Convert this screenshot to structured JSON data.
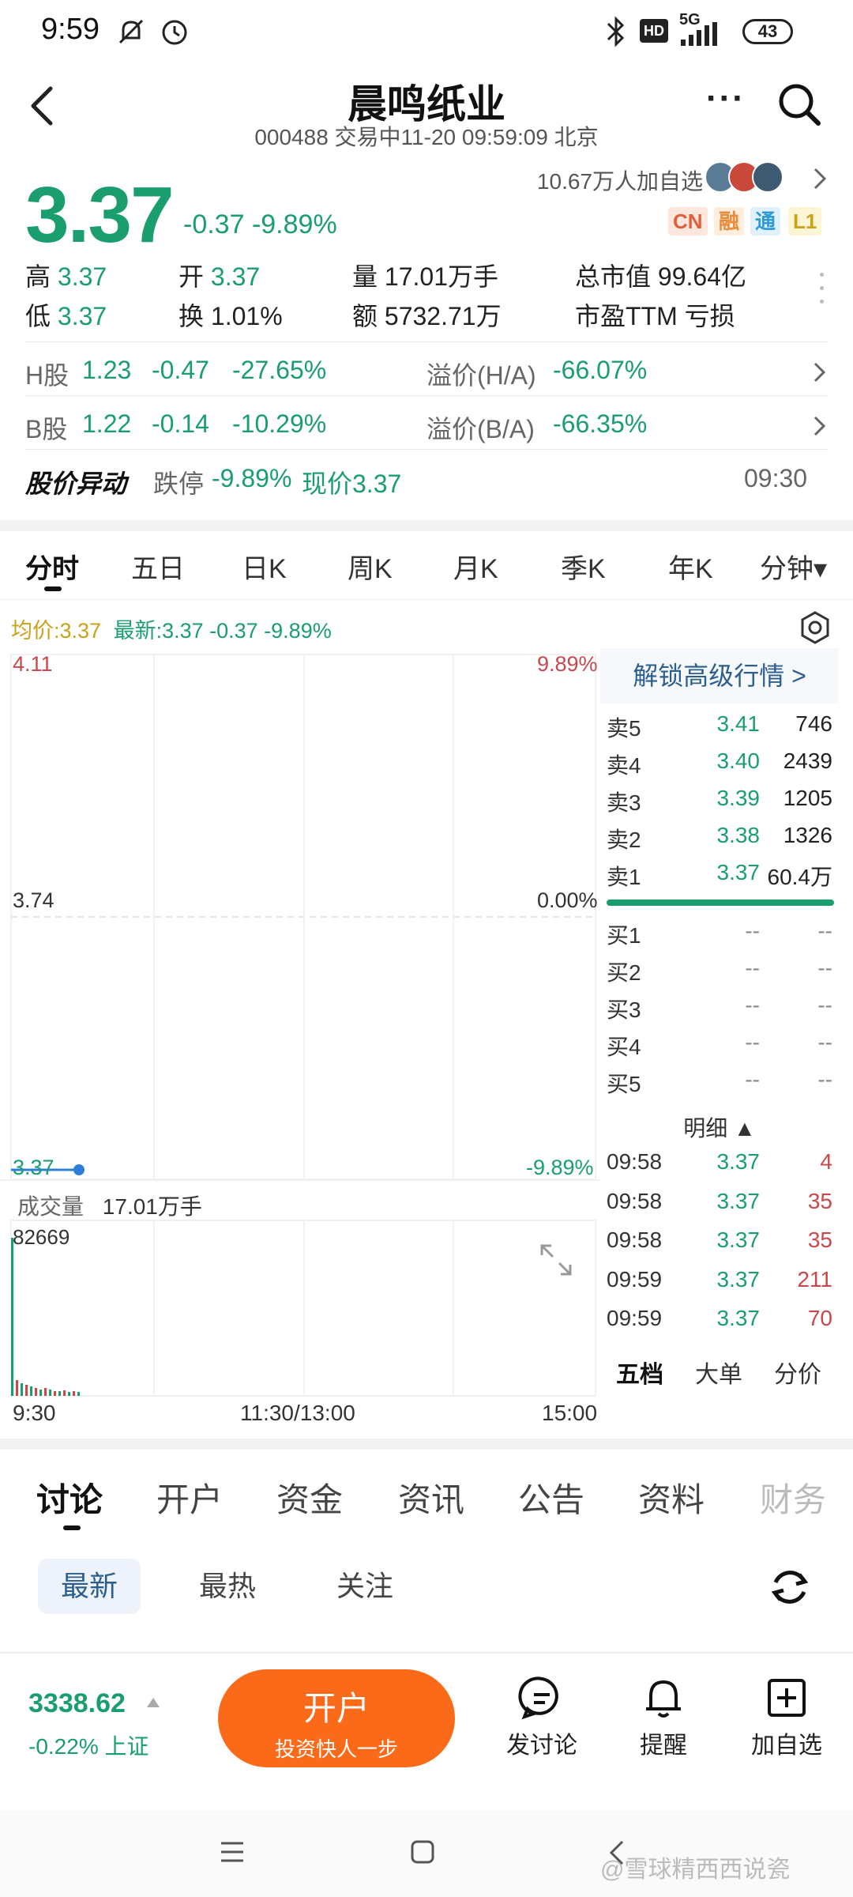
{
  "status_bar": {
    "time": "9:59",
    "network": "5G",
    "battery": "43"
  },
  "header": {
    "title": "晨鸣纸业",
    "subtitle": "000488 交易中11-20 09:59:09 北京"
  },
  "quote": {
    "price": "3.37",
    "change": "-0.37",
    "change_pct": "-9.89%",
    "watchers": "10.67万人加自选",
    "badges": [
      "CN",
      "融",
      "通",
      "L1"
    ],
    "stats": [
      {
        "label": "高",
        "value": "3.37"
      },
      {
        "label": "开",
        "value": "3.37"
      },
      {
        "label": "量",
        "value": "17.01万手"
      },
      {
        "label": "总市值",
        "value": "99.64亿"
      },
      {
        "label": "低",
        "value": "3.37"
      },
      {
        "label": "换",
        "value": "1.01%"
      },
      {
        "label": "额",
        "value": "5732.71万"
      },
      {
        "label": "市盈TTM",
        "value": "亏损"
      }
    ]
  },
  "hshares": {
    "label": "H股",
    "price": "1.23",
    "chg": "-0.47",
    "pct": "-27.65%",
    "prem_label": "溢价(H/A)",
    "prem": "-66.07%"
  },
  "bshares": {
    "label": "B股",
    "price": "1.22",
    "chg": "-0.14",
    "pct": "-10.29%",
    "prem_label": "溢价(B/A)",
    "prem": "-66.35%"
  },
  "alert": {
    "title": "股价异动",
    "text_prefix": "跌停",
    "text_pct": "-9.89%",
    "text_suffix": "现价3.37",
    "time": "09:30"
  },
  "chart_tabs": [
    "分时",
    "五日",
    "日K",
    "周K",
    "月K",
    "季K",
    "年K",
    "分钟▾"
  ],
  "chart": {
    "avg_label": "均价:3.37",
    "latest_label": "最新:3.37 -0.37 -9.89%",
    "y_top": "4.11",
    "y_mid": "3.74",
    "y_bot": "3.37",
    "pct_top": "9.89%",
    "pct_mid": "0.00%",
    "pct_bot": "-9.89%",
    "volume_label": "成交量",
    "volume_value": "17.01万手",
    "volume_max": "82669",
    "x_labels": [
      "9:30",
      "11:30/13:00",
      "15:00"
    ]
  },
  "orderbook": {
    "unlock": "解锁高级行情 >",
    "asks": [
      {
        "label": "卖5",
        "price": "3.41",
        "vol": "746"
      },
      {
        "label": "卖4",
        "price": "3.40",
        "vol": "2439"
      },
      {
        "label": "卖3",
        "price": "3.39",
        "vol": "1205"
      },
      {
        "label": "卖2",
        "price": "3.38",
        "vol": "1326"
      },
      {
        "label": "卖1",
        "price": "3.37",
        "vol": "60.4万"
      }
    ],
    "bids": [
      {
        "label": "买1",
        "price": "--",
        "vol": "--"
      },
      {
        "label": "买2",
        "price": "--",
        "vol": "--"
      },
      {
        "label": "买3",
        "price": "--",
        "vol": "--"
      },
      {
        "label": "买4",
        "price": "--",
        "vol": "--"
      },
      {
        "label": "买5",
        "price": "--",
        "vol": "--"
      }
    ],
    "detail_label": "明细 ▲",
    "trades": [
      {
        "time": "09:58",
        "price": "3.37",
        "vol": "4"
      },
      {
        "time": "09:58",
        "price": "3.37",
        "vol": "35"
      },
      {
        "time": "09:58",
        "price": "3.37",
        "vol": "35"
      },
      {
        "time": "09:59",
        "price": "3.37",
        "vol": "211"
      },
      {
        "time": "09:59",
        "price": "3.37",
        "vol": "70"
      }
    ],
    "tabs": [
      "五档",
      "大单",
      "分价"
    ]
  },
  "section_tabs": [
    "讨论",
    "开户",
    "资金",
    "资讯",
    "公告",
    "资料",
    "财务"
  ],
  "sub_tabs": [
    "最新",
    "最热",
    "关注"
  ],
  "bottom": {
    "index_value": "3338.62",
    "index_change": "-0.22% 上证",
    "open_title": "开户",
    "open_sub": "投资快人一步",
    "actions": [
      "发讨论",
      "提醒",
      "加自选"
    ]
  },
  "watermark": "@雪球精西西说瓷"
}
